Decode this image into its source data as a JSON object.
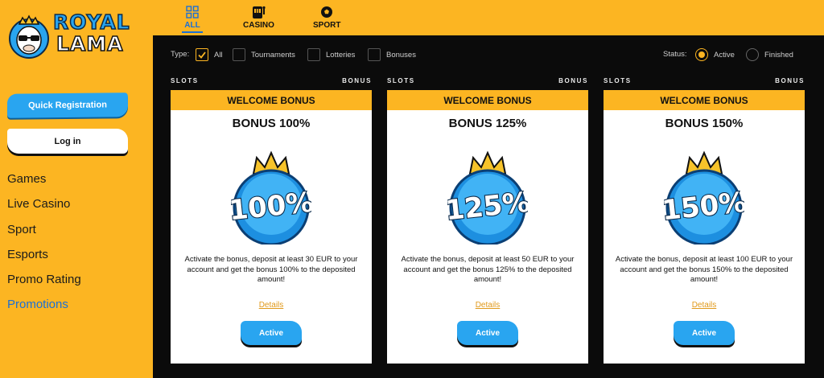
{
  "brand": {
    "line1": "ROYAL",
    "line2": "LAMA"
  },
  "sidebar": {
    "quick_registration": "Quick Registration",
    "login": "Log in",
    "nav": [
      "Games",
      "Live Casino",
      "Sport",
      "Esports",
      "Promo Rating",
      "Promotions"
    ],
    "active_nav": "Promotions"
  },
  "tabs": [
    {
      "label": "ALL",
      "icon": "grid-icon",
      "active": true
    },
    {
      "label": "CASINO",
      "icon": "slot-machine-icon",
      "active": false
    },
    {
      "label": "SPORT",
      "icon": "soccer-ball-icon",
      "active": false
    }
  ],
  "filters": {
    "type_label": "Type:",
    "types": [
      {
        "label": "All",
        "checked": true
      },
      {
        "label": "Tournaments",
        "checked": false
      },
      {
        "label": "Lotteries",
        "checked": false
      },
      {
        "label": "Bonuses",
        "checked": false
      }
    ],
    "status_label": "Status:",
    "statuses": [
      {
        "label": "Active",
        "selected": true
      },
      {
        "label": "Finished",
        "selected": false
      }
    ]
  },
  "cards": [
    {
      "category": "SLOTS",
      "kind": "BONUS",
      "banner": "WELCOME BONUS",
      "title": "BONUS 100%",
      "badge": "100%",
      "description": "Activate the bonus, deposit at least 30 EUR to your account and get the bonus 100% to the deposited amount!",
      "details": "Details",
      "button": "Active"
    },
    {
      "category": "SLOTS",
      "kind": "BONUS",
      "banner": "WELCOME BONUS",
      "title": "BONUS 125%",
      "badge": "125%",
      "description": "Activate the bonus, deposit at least 50 EUR to your account and get the bonus 125% to the deposited amount!",
      "details": "Details",
      "button": "Active"
    },
    {
      "category": "SLOTS",
      "kind": "BONUS",
      "banner": "WELCOME BONUS",
      "title": "BONUS 150%",
      "badge": "150%",
      "description": "Activate the bonus, deposit at least 100 EUR to your account and get the bonus 150% to the deposited amount!",
      "details": "Details",
      "button": "Active"
    }
  ],
  "colors": {
    "accent": "#fcb522",
    "blue": "#29a5f0",
    "link_blue": "#1a6fd6",
    "background": "#0b0b0b"
  }
}
